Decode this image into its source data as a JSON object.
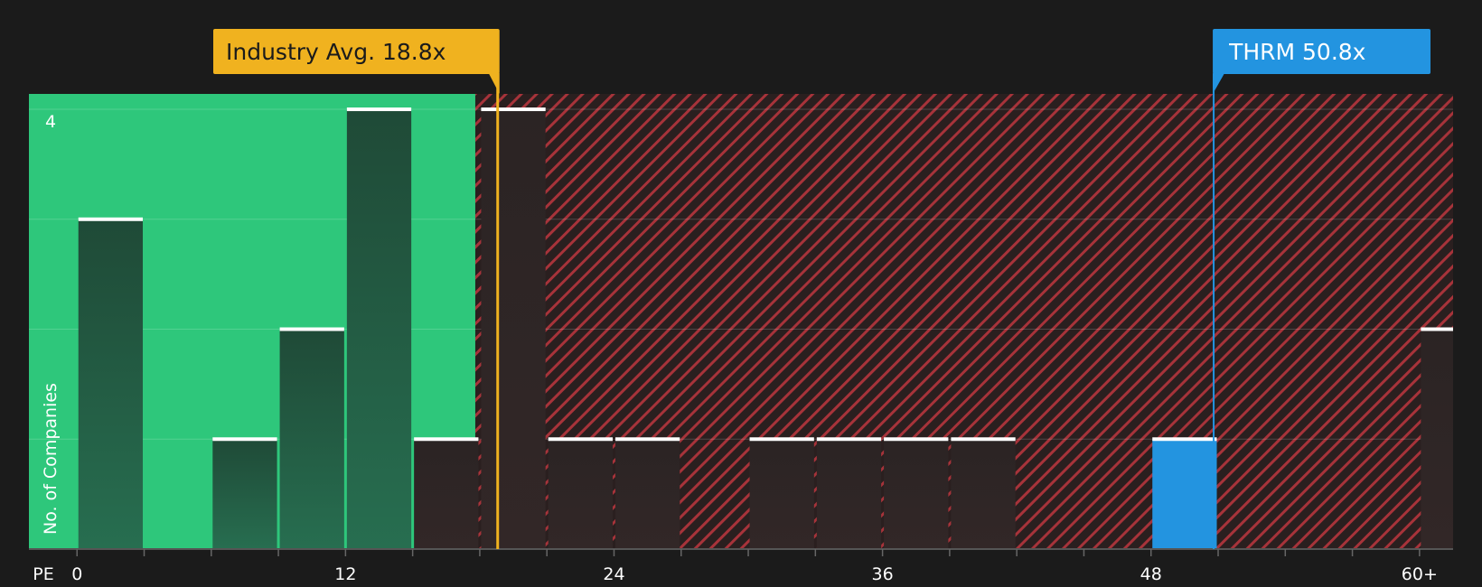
{
  "chart_data": {
    "type": "bar",
    "xlabel": "PE",
    "ylabel": "No. of Companies",
    "x_tick_labels": [
      "0",
      "12",
      "24",
      "36",
      "48",
      "60+"
    ],
    "x_ticks": [
      0,
      12,
      24,
      36,
      48,
      60
    ],
    "y_tick_labels": [
      "4"
    ],
    "y_ticks": [
      4
    ],
    "xlim": [
      -2.15,
      61.5
    ],
    "ylim": [
      0,
      4.14
    ],
    "grid": true,
    "bin_width": 3,
    "bins": [
      {
        "x_start": 0,
        "count": 3
      },
      {
        "x_start": 3,
        "count": 0
      },
      {
        "x_start": 6,
        "count": 1
      },
      {
        "x_start": 9,
        "count": 2
      },
      {
        "x_start": 12,
        "count": 4
      },
      {
        "x_start": 15,
        "count": 1
      },
      {
        "x_start": 18,
        "count": 4
      },
      {
        "x_start": 21,
        "count": 1
      },
      {
        "x_start": 24,
        "count": 1
      },
      {
        "x_start": 27,
        "count": 0
      },
      {
        "x_start": 30,
        "count": 1
      },
      {
        "x_start": 33,
        "count": 1
      },
      {
        "x_start": 36,
        "count": 1
      },
      {
        "x_start": 39,
        "count": 1
      },
      {
        "x_start": 42,
        "count": 0
      },
      {
        "x_start": 45,
        "count": 0
      },
      {
        "x_start": 48,
        "count": 1,
        "highlight": true
      },
      {
        "x_start": 51,
        "count": 0
      },
      {
        "x_start": 54,
        "count": 0
      },
      {
        "x_start": 57,
        "count": 0
      },
      {
        "x_start": 60,
        "count": 2
      }
    ],
    "markers": [
      {
        "label": "Industry Avg. 18.8x",
        "value": 18.8,
        "color": "#f0b21f"
      },
      {
        "label": "THRM 50.8x",
        "value": 50.8,
        "color": "#2394e0"
      }
    ],
    "colors": {
      "good_zone": "#2ec77b",
      "bad_zone": "#a7333a",
      "highlight_bar": "#2394e0",
      "background": "#1b1b1b"
    }
  }
}
